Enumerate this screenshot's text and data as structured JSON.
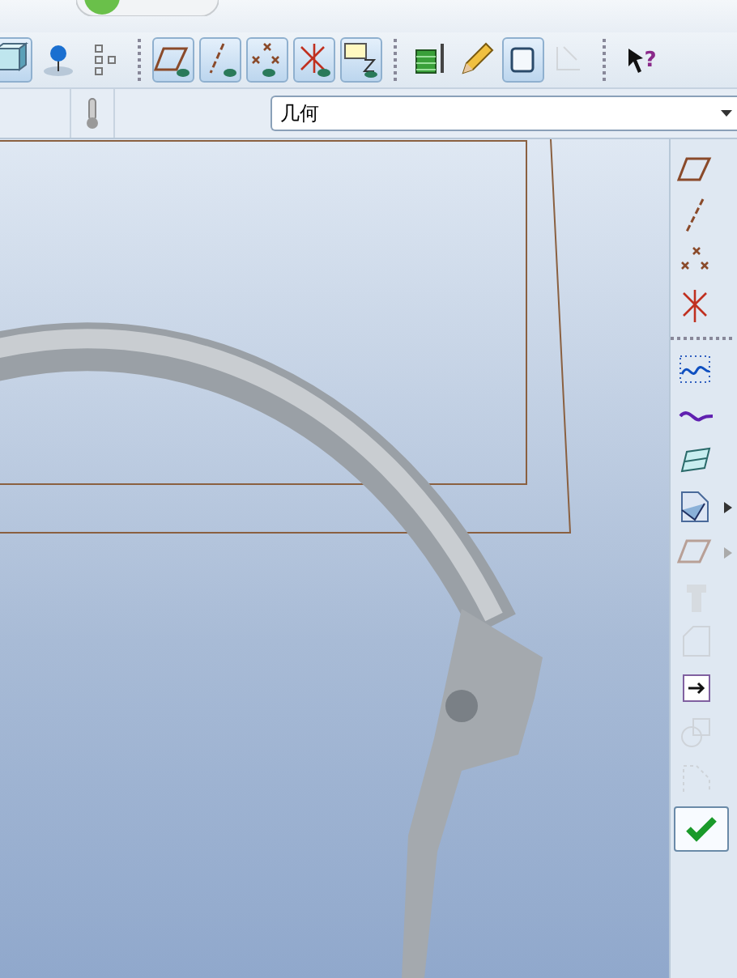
{
  "top_toolbar": [
    {
      "kind": "shaded-cube",
      "pressed": true,
      "disabled": false
    },
    {
      "kind": "pin",
      "pressed": false,
      "disabled": false
    },
    {
      "kind": "tree-dots",
      "pressed": false,
      "disabled": false
    },
    {
      "kind": "sep"
    },
    {
      "kind": "plane-display",
      "pressed": true,
      "disabled": false
    },
    {
      "kind": "axis-display",
      "pressed": true,
      "disabled": false
    },
    {
      "kind": "point-display",
      "pressed": true,
      "disabled": false
    },
    {
      "kind": "csys-display",
      "pressed": true,
      "disabled": false
    },
    {
      "kind": "note-display",
      "pressed": true,
      "disabled": false
    },
    {
      "kind": "sep"
    },
    {
      "kind": "spool",
      "pressed": false,
      "disabled": false
    },
    {
      "kind": "pencil",
      "pressed": false,
      "disabled": false
    },
    {
      "kind": "cube",
      "pressed": true,
      "disabled": false
    },
    {
      "kind": "sketch",
      "pressed": false,
      "disabled": true
    },
    {
      "kind": "sep"
    },
    {
      "kind": "help",
      "pressed": false,
      "disabled": false,
      "glyph": "?"
    }
  ],
  "filter": {
    "value": "几何"
  },
  "right_toolbar": [
    {
      "kind": "plane",
      "disabled": false,
      "menu": false
    },
    {
      "kind": "axis",
      "disabled": false,
      "menu": false
    },
    {
      "kind": "point",
      "disabled": false,
      "menu": false
    },
    {
      "kind": "csys",
      "disabled": false,
      "menu": false
    },
    {
      "kind": "sep"
    },
    {
      "kind": "sketch-curve",
      "disabled": false,
      "menu": false
    },
    {
      "kind": "curve",
      "disabled": false,
      "menu": false
    },
    {
      "kind": "surface",
      "disabled": false,
      "menu": false
    },
    {
      "kind": "analysis",
      "disabled": false,
      "menu": true
    },
    {
      "kind": "plane",
      "disabled": true,
      "menu": true
    },
    {
      "kind": "extrude",
      "disabled": true,
      "menu": false
    },
    {
      "kind": "corner",
      "disabled": true,
      "menu": false
    },
    {
      "kind": "insert",
      "disabled": false,
      "menu": false
    },
    {
      "kind": "blend",
      "disabled": true,
      "menu": false
    },
    {
      "kind": "sweep",
      "disabled": true,
      "menu": false
    },
    {
      "kind": "confirm",
      "disabled": false,
      "menu": false
    }
  ]
}
